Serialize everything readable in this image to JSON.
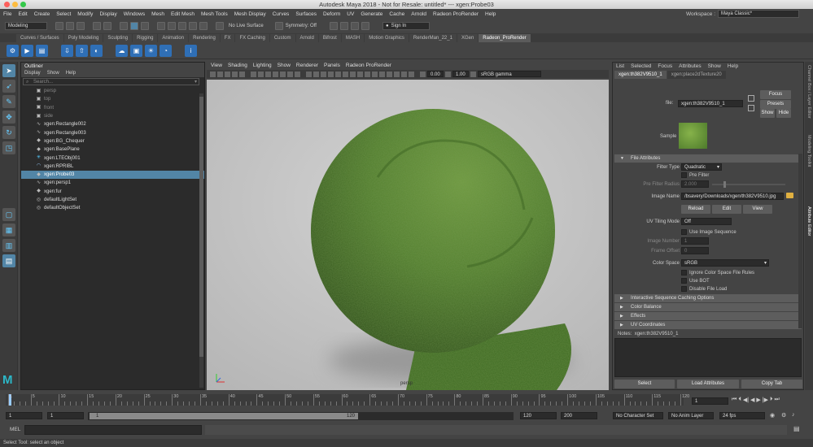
{
  "window": {
    "title": "Autodesk Maya 2018 - Not for Resale: untitled*   ---   xgen:Probe03"
  },
  "menubar": [
    "File",
    "Edit",
    "Create",
    "Select",
    "Modify",
    "Display",
    "Windows",
    "Mesh",
    "Edit Mesh",
    "Mesh Tools",
    "Mesh Display",
    "Curves",
    "Surfaces",
    "Deform",
    "UV",
    "Generate",
    "Cache",
    "Arnold",
    "Radeon ProRender",
    "Help"
  ],
  "workspace": {
    "label": "Workspace :",
    "value": "Maya Classic*"
  },
  "statusline": {
    "mode": "Modeling",
    "live_surface": "No Live Surface",
    "symmetry": "Symmetry: Off",
    "sign_in": "Sign In"
  },
  "shelf_tabs": [
    "Curves / Surfaces",
    "Poly Modeling",
    "Sculpting",
    "Rigging",
    "Animation",
    "Rendering",
    "FX",
    "FX Caching",
    "Custom",
    "Arnold",
    "Bifrost",
    "MASH",
    "Motion Graphics",
    "RenderMan_22_1",
    "XGen",
    "Radeon_ProRender"
  ],
  "shelf_active": "Radeon_ProRender",
  "outliner": {
    "title": "Outliner",
    "menu": [
      "Display",
      "Show",
      "Help"
    ],
    "search_placeholder": "Search...",
    "items": [
      {
        "label": "persp",
        "icon": "camera-icon",
        "dim": true
      },
      {
        "label": "top",
        "icon": "camera-icon",
        "dim": true
      },
      {
        "label": "front",
        "icon": "camera-icon",
        "dim": true
      },
      {
        "label": "side",
        "icon": "camera-icon",
        "dim": true
      },
      {
        "label": "xgen:Rectangle002",
        "icon": "curve-icon"
      },
      {
        "label": "xgen:Rectangle003",
        "icon": "curve-icon"
      },
      {
        "label": "xgen:BG_Chequer",
        "icon": "mesh-icon"
      },
      {
        "label": "xgen:BasePlane",
        "icon": "mesh-icon"
      },
      {
        "label": "xgen:LTEObj001",
        "icon": "light-icon"
      },
      {
        "label": "xgen:RPRIBL",
        "icon": "ibl-icon"
      },
      {
        "label": "xgen:Probe03",
        "icon": "mesh-icon",
        "selected": true
      },
      {
        "label": "xgen:persp1",
        "icon": "curve-icon"
      },
      {
        "label": "xgen:fur",
        "icon": "mesh-icon"
      },
      {
        "label": "defaultLightSet",
        "icon": "set-icon"
      },
      {
        "label": "defaultObjectSet",
        "icon": "set-icon"
      }
    ]
  },
  "viewport": {
    "menu": [
      "View",
      "Shading",
      "Lighting",
      "Show",
      "Renderer",
      "Panels",
      "Radeon ProRender"
    ],
    "exposure": "0.00",
    "gamma": "1.00",
    "colorspace": "sRGB gamma",
    "camera_label": "persp"
  },
  "attribute_editor": {
    "menu": [
      "List",
      "Selected",
      "Focus",
      "Attributes",
      "Show",
      "Help"
    ],
    "tabs": [
      "xgen:th382V9510_1",
      "xgen:place2dTexture20"
    ],
    "file_label": "file:",
    "file_value": "xgen:th382V9510_1",
    "focus": "Focus",
    "presets": "Presets",
    "show": "Show",
    "hide": "Hide",
    "sample_label": "Sample",
    "file_attributes": "File Attributes",
    "filter_type_label": "Filter Type",
    "filter_type_value": "Quadratic",
    "pre_filter": "Pre Filter",
    "pre_filter_radius_label": "Pre Filter Radius",
    "pre_filter_radius_value": "2.000",
    "image_name_label": "Image Name",
    "image_name_value": "/bsavery/Downloads/xgen/th382V9510.jpg",
    "reload": "Reload",
    "edit": "Edit",
    "view": "View",
    "uv_tiling_label": "UV Tiling Mode",
    "uv_tiling_value": "Off",
    "use_image_sequence": "Use Image Sequence",
    "image_number_label": "Image Number",
    "image_number_value": "1",
    "frame_offset_label": "Frame Offset",
    "frame_offset_value": "0",
    "color_space_label": "Color Space",
    "color_space_value": "sRGB",
    "ignore_cs": "Ignore Color Space File Rules",
    "use_bot": "Use BOT",
    "disable_file_load": "Disable File Load",
    "sections": [
      "Interactive Sequence Caching Options",
      "Color Balance",
      "Effects",
      "UV Coordinates"
    ],
    "notes_label": "Notes:",
    "notes_value": "xgen:th382V9510_1",
    "select": "Select",
    "load_attributes": "Load Attributes",
    "copy_tab": "Copy Tab"
  },
  "side_tabs": [
    "Channel Box / Layer Editor",
    "Modeling Toolkit",
    "Attribute Editor"
  ],
  "timeslider": {
    "ticks": [
      "1",
      "5",
      "10",
      "15",
      "20",
      "25",
      "30",
      "35",
      "40",
      "45",
      "50",
      "55",
      "60",
      "65",
      "70",
      "75",
      "80",
      "85",
      "90",
      "95",
      "100",
      "105",
      "110",
      "115",
      "120"
    ],
    "current_frame": "1"
  },
  "range": {
    "start": "1",
    "inner_start": "1",
    "slider_start": "1",
    "slider_end": "120",
    "end": "120",
    "anim_end": "200",
    "character_set": "No Character Set",
    "anim_layer": "No Anim Layer",
    "fps": "24 fps"
  },
  "cmdline": {
    "label": "MEL"
  },
  "help": "Select Tool: select an object",
  "colors": {
    "accent": "#5285a6",
    "fur": "#4d7a2b",
    "shelf_blue": "#2f6fb6"
  }
}
